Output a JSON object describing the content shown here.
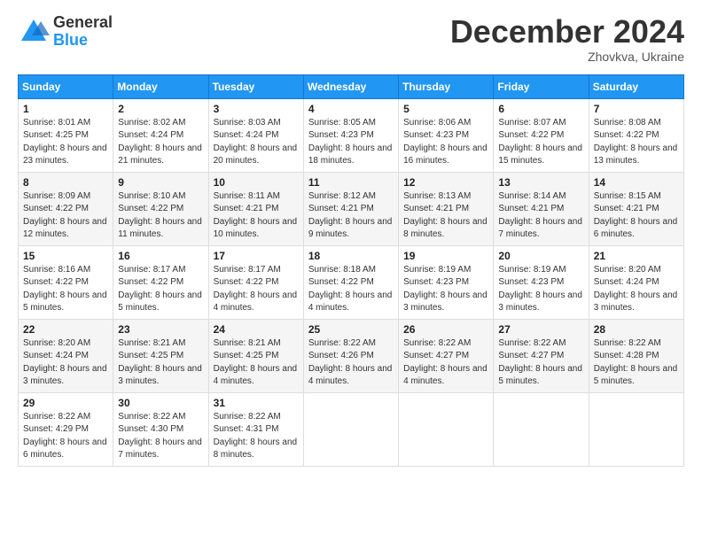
{
  "logo": {
    "general": "General",
    "blue": "Blue"
  },
  "title": "December 2024",
  "subtitle": "Zhovkva, Ukraine",
  "weekdays": [
    "Sunday",
    "Monday",
    "Tuesday",
    "Wednesday",
    "Thursday",
    "Friday",
    "Saturday"
  ],
  "weeks": [
    [
      {
        "day": "1",
        "sunrise": "8:01 AM",
        "sunset": "4:25 PM",
        "daylight": "8 hours and 23 minutes."
      },
      {
        "day": "2",
        "sunrise": "8:02 AM",
        "sunset": "4:24 PM",
        "daylight": "8 hours and 21 minutes."
      },
      {
        "day": "3",
        "sunrise": "8:03 AM",
        "sunset": "4:24 PM",
        "daylight": "8 hours and 20 minutes."
      },
      {
        "day": "4",
        "sunrise": "8:05 AM",
        "sunset": "4:23 PM",
        "daylight": "8 hours and 18 minutes."
      },
      {
        "day": "5",
        "sunrise": "8:06 AM",
        "sunset": "4:23 PM",
        "daylight": "8 hours and 16 minutes."
      },
      {
        "day": "6",
        "sunrise": "8:07 AM",
        "sunset": "4:22 PM",
        "daylight": "8 hours and 15 minutes."
      },
      {
        "day": "7",
        "sunrise": "8:08 AM",
        "sunset": "4:22 PM",
        "daylight": "8 hours and 13 minutes."
      }
    ],
    [
      {
        "day": "8",
        "sunrise": "8:09 AM",
        "sunset": "4:22 PM",
        "daylight": "8 hours and 12 minutes."
      },
      {
        "day": "9",
        "sunrise": "8:10 AM",
        "sunset": "4:22 PM",
        "daylight": "8 hours and 11 minutes."
      },
      {
        "day": "10",
        "sunrise": "8:11 AM",
        "sunset": "4:21 PM",
        "daylight": "8 hours and 10 minutes."
      },
      {
        "day": "11",
        "sunrise": "8:12 AM",
        "sunset": "4:21 PM",
        "daylight": "8 hours and 9 minutes."
      },
      {
        "day": "12",
        "sunrise": "8:13 AM",
        "sunset": "4:21 PM",
        "daylight": "8 hours and 8 minutes."
      },
      {
        "day": "13",
        "sunrise": "8:14 AM",
        "sunset": "4:21 PM",
        "daylight": "8 hours and 7 minutes."
      },
      {
        "day": "14",
        "sunrise": "8:15 AM",
        "sunset": "4:21 PM",
        "daylight": "8 hours and 6 minutes."
      }
    ],
    [
      {
        "day": "15",
        "sunrise": "8:16 AM",
        "sunset": "4:22 PM",
        "daylight": "8 hours and 5 minutes."
      },
      {
        "day": "16",
        "sunrise": "8:17 AM",
        "sunset": "4:22 PM",
        "daylight": "8 hours and 5 minutes."
      },
      {
        "day": "17",
        "sunrise": "8:17 AM",
        "sunset": "4:22 PM",
        "daylight": "8 hours and 4 minutes."
      },
      {
        "day": "18",
        "sunrise": "8:18 AM",
        "sunset": "4:22 PM",
        "daylight": "8 hours and 4 minutes."
      },
      {
        "day": "19",
        "sunrise": "8:19 AM",
        "sunset": "4:23 PM",
        "daylight": "8 hours and 3 minutes."
      },
      {
        "day": "20",
        "sunrise": "8:19 AM",
        "sunset": "4:23 PM",
        "daylight": "8 hours and 3 minutes."
      },
      {
        "day": "21",
        "sunrise": "8:20 AM",
        "sunset": "4:24 PM",
        "daylight": "8 hours and 3 minutes."
      }
    ],
    [
      {
        "day": "22",
        "sunrise": "8:20 AM",
        "sunset": "4:24 PM",
        "daylight": "8 hours and 3 minutes."
      },
      {
        "day": "23",
        "sunrise": "8:21 AM",
        "sunset": "4:25 PM",
        "daylight": "8 hours and 3 minutes."
      },
      {
        "day": "24",
        "sunrise": "8:21 AM",
        "sunset": "4:25 PM",
        "daylight": "8 hours and 4 minutes."
      },
      {
        "day": "25",
        "sunrise": "8:22 AM",
        "sunset": "4:26 PM",
        "daylight": "8 hours and 4 minutes."
      },
      {
        "day": "26",
        "sunrise": "8:22 AM",
        "sunset": "4:27 PM",
        "daylight": "8 hours and 4 minutes."
      },
      {
        "day": "27",
        "sunrise": "8:22 AM",
        "sunset": "4:27 PM",
        "daylight": "8 hours and 5 minutes."
      },
      {
        "day": "28",
        "sunrise": "8:22 AM",
        "sunset": "4:28 PM",
        "daylight": "8 hours and 5 minutes."
      }
    ],
    [
      {
        "day": "29",
        "sunrise": "8:22 AM",
        "sunset": "4:29 PM",
        "daylight": "8 hours and 6 minutes."
      },
      {
        "day": "30",
        "sunrise": "8:22 AM",
        "sunset": "4:30 PM",
        "daylight": "8 hours and 7 minutes."
      },
      {
        "day": "31",
        "sunrise": "8:22 AM",
        "sunset": "4:31 PM",
        "daylight": "8 hours and 8 minutes."
      },
      null,
      null,
      null,
      null
    ]
  ],
  "labels": {
    "sunrise": "Sunrise:",
    "sunset": "Sunset:",
    "daylight": "Daylight:"
  }
}
